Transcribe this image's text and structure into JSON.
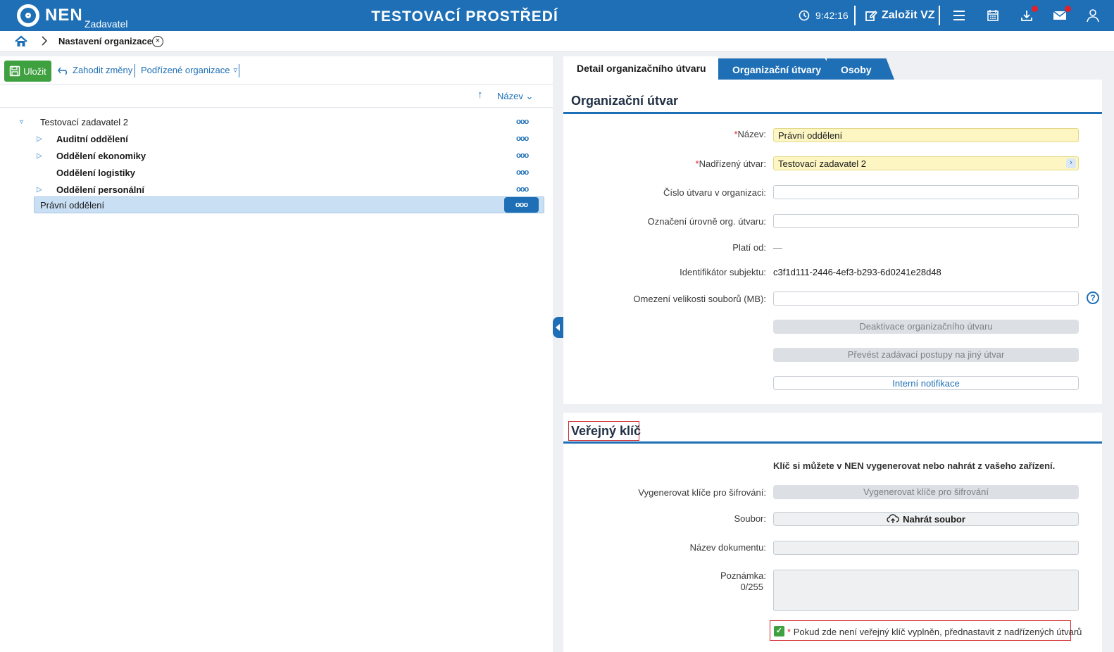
{
  "header": {
    "logo": "NEN",
    "logo_sub": "Zadavatel",
    "env_title": "TESTOVACÍ PROSTŘEDÍ",
    "clock": "9:42:16",
    "create_label": "Založit VZ",
    "icons": [
      "clock-icon",
      "edit-icon",
      "menu-icon",
      "calendar-icon",
      "download-icon",
      "mail-icon",
      "user-icon"
    ],
    "accent_color": "#1e6fb5",
    "notification_color": "#e3202a"
  },
  "breadcrumb": {
    "current": "Nastavení organizace",
    "close_symbol": "×"
  },
  "toolbar": {
    "save_label": "Uložit",
    "discard_label": "Zahodit změny",
    "child_orgs_label": "Podřízené organizace",
    "dropdown_symbol": "▿",
    "save_color": "#3fa03f"
  },
  "sort": {
    "arrow": "↑",
    "label": "Název ⌄"
  },
  "tree": {
    "root": "Testovací zadavatel 2",
    "items": [
      {
        "label": "Auditní oddělení",
        "toggle": "▷"
      },
      {
        "label": "Oddělení ekonomiky",
        "toggle": "▷"
      },
      {
        "label": "Oddělení logistiky",
        "toggle": ""
      },
      {
        "label": "Oddělení personální",
        "toggle": "▷"
      }
    ],
    "selected": "Právní oddělení",
    "root_toggle": "▿",
    "dots": "ooo"
  },
  "tabs": {
    "active": "Detail organizačního útvaru",
    "items": [
      "Organizační útvary",
      "Osoby"
    ]
  },
  "org_unit": {
    "title": "Organizační útvar",
    "required_mark": "*",
    "name_label": "Název",
    "name_value": "Právní oddělení",
    "parent_label": "Nadřízený útvar",
    "parent_value": "Testovací zadavatel 2",
    "picker_symbol": "›",
    "number_label": "Číslo útvaru v organizaci",
    "number_value": "",
    "level_label": "Označení úrovně org. útvaru",
    "level_value": "",
    "valid_from_label": "Platí od",
    "valid_from_value": "—",
    "subject_id_label": "Identifikátor subjektu",
    "subject_id_value": "c3f1d111-2446-4ef3-b293-6d0241e28d48",
    "file_limit_label": "Omezení velikosti souborů (MB)",
    "file_limit_value": "",
    "help_symbol": "?",
    "deactivate_label": "Deaktivace organizačního útvaru",
    "transfer_label": "Převést zadávací postupy na jiný útvar",
    "notifications_label": "Interní notifikace"
  },
  "public_key": {
    "title": "Veřejný klíč",
    "info": "Klíč si můžete v NEN vygenerovat nebo nahrát z vašeho zařízení.",
    "generate_label": "Vygenerovat klíče pro šifrování",
    "generate_button": "Vygenerovat klíče pro šifrování",
    "file_label": "Soubor",
    "upload_button": "Nahrát soubor",
    "doc_name_label": "Název dokumentu",
    "doc_name_value": "",
    "note_label": "Poznámka",
    "note_counter": "0/255",
    "note_value": "",
    "checkbox_label": "Pokud zde není veřejný klíč vyplněn, přednastavit z nadřízených útvarů",
    "checkbox_checked": true,
    "check_symbol": "✓"
  },
  "colon": ":"
}
